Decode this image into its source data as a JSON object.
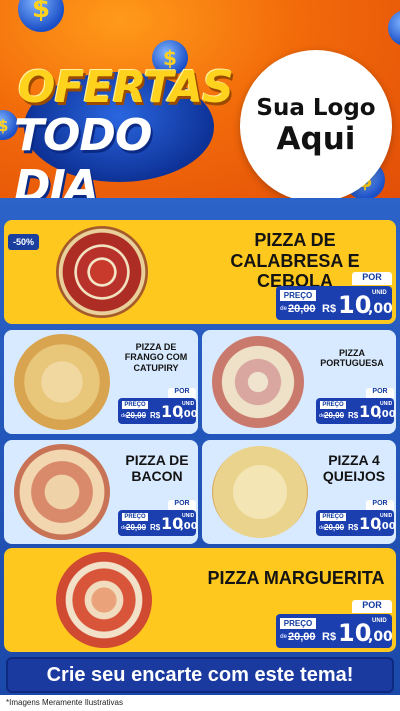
{
  "header": {
    "title_line1": "OFERTAS",
    "title_line2": "TODO DIA",
    "logo_line1": "Sua Logo",
    "logo_line2": "Aqui",
    "coin_symbol": "$"
  },
  "products": [
    {
      "name": "PIZZA DE CALABRESA E CEBOLA",
      "badge": "-50%",
      "price_label": "PREÇO",
      "de": "de",
      "old_price": "20,00",
      "por": "POR",
      "currency": "R$",
      "price_int": "10",
      "price_cents": ",00",
      "unit": "UNID"
    },
    {
      "name": "PIZZA DE FRANGO COM CATUPIRY",
      "price_label": "PREÇO",
      "de": "de",
      "old_price": "20,00",
      "por": "POR",
      "currency": "R$",
      "price_int": "10",
      "price_cents": ",00",
      "unit": "UNID"
    },
    {
      "name": "PIZZA PORTUGUESA",
      "price_label": "PREÇO",
      "de": "de",
      "old_price": "20,00",
      "por": "POR",
      "currency": "R$",
      "price_int": "10",
      "price_cents": ",00",
      "unit": "UNID"
    },
    {
      "name": "PIZZA DE BACON",
      "price_label": "PREÇO",
      "de": "de",
      "old_price": "20,00",
      "por": "POR",
      "currency": "R$",
      "price_int": "10",
      "price_cents": ",00",
      "unit": "UNID"
    },
    {
      "name": "PIZZA 4 QUEIJOS",
      "price_label": "PREÇO",
      "de": "de",
      "old_price": "20,00",
      "por": "POR",
      "currency": "R$",
      "price_int": "10",
      "price_cents": ",00",
      "unit": "UNID"
    },
    {
      "name": "PIZZA MARGUERITA",
      "price_label": "PREÇO",
      "de": "de",
      "old_price": "20,00",
      "por": "POR",
      "currency": "R$",
      "price_int": "10",
      "price_cents": ",00",
      "unit": "UNID"
    }
  ],
  "cta": "Crie seu encarte com este tema!",
  "footnote": "*Imagens Meramente Ilustrativas",
  "colors": {
    "orange": "#f26a0a",
    "yellow": "#ffc81f",
    "blue": "#1b3fae",
    "red": "#e21c1c"
  }
}
